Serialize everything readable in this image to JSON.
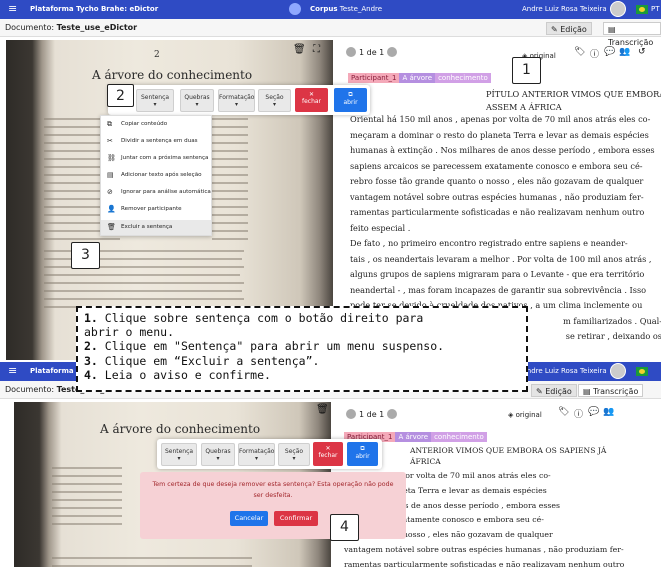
{
  "topbar": {
    "brand": "Plataforma Tycho Brahe: eDictor",
    "corpus_prefix": "Corpus",
    "corpus_name": "Teste_Andre",
    "user": "Andre Luiz Rosa Teixeira",
    "lang": "PT"
  },
  "docbar": {
    "label": "Documento:",
    "doc": "Teste_use_eDictor",
    "tab_edit": "Edição",
    "tab_trans": "Transcrição"
  },
  "image": {
    "page_num": "2",
    "title": "A árvore do conhecimento"
  },
  "nav": {
    "page": "1 de 1",
    "original": "original"
  },
  "tags": {
    "participant": "Participant_1",
    "tag2": "A árvore",
    "tag3": "conhecimento"
  },
  "toolbar": {
    "sentenca": "Sentença",
    "quebras": "Quebras",
    "formatacao": "Formatação",
    "secao": "Seção",
    "fechar": "fechar",
    "abrir": "abrir"
  },
  "menu": {
    "items": [
      "Copiar conteúdo",
      "Dividir a sentença em duas",
      "Juntar com a próxima sentença",
      "Adicionar texto após seleção",
      "Ignorar para análise automática",
      "Remover participante",
      "Excluir a sentença"
    ]
  },
  "text": {
    "l1": "PÍTULO ANTERIOR VIMOS QUE EMBORA OS SAPIENS JÁ",
    "l2": "ASSEM A ÁFRICA",
    "p": [
      "Oriental há 150 mil anos , apenas por volta de 70 mil anos atrás eles co-",
      "meçaram a dominar o resto do planeta Terra e levar as demais espécies",
      "humanas à extinção . Nos milhares de anos desse período , embora esses",
      "sapiens arcaicos se parecessem exatamente conosco e embora seu cé-",
      "rebro fosse tão grande quanto o nosso , eles não gozavam de qualquer",
      "vantagem notável sobre outras espécies humanas , não produziam fer-",
      "ramentas particularmente sofisticadas e não realizavam nenhum outro",
      "feito especial .",
      "De fato , no primeiro encontro registrado entre sapiens e neander-",
      "tais , os neandertais levaram a melhor . Por volta de 100 mil anos atrás ,",
      "alguns grupos de sapiens migraram para o Levante - que era território",
      "neandertal - , mas foram incapazes de garantir sua sobrevivência . Isso",
      "pode ter se devido à crueldade dos nativos , a um clima inclemente ou",
      "m familiarizados . Qual-",
      "se retirar , deixando os"
    ]
  },
  "instructions": {
    "n1": "1.",
    "t1": " Clique sobre sentença com o botão direito para",
    "t1b": "abrir o menu.",
    "n2": "2.",
    "t2": " Clique em \"Sentença\" para abrir um menu suspenso.",
    "n3": "3.",
    "t3": " Clique em “Excluir a sentença”.",
    "n4": "4.",
    "t4": " Leia o aviso e confirme."
  },
  "dialog": {
    "msg": "Tem certeza de que deseja remover esta sentença? Esta operação não pode ser desfeita.",
    "cancel": "Cancelar",
    "confirm": "Confirmar"
  },
  "bottom_text": {
    "h1": "ANTERIOR VIMOS QUE EMBORA OS SAPIENS JÁ",
    "h2": "ÁFRICA",
    "p": [
      "anos , apenas por volta de 70 mil anos atrás eles co-",
      "o resto do planeta Terra e levar as demais espécies",
      "o . Nos milhares de anos desse período , embora esses",
      "parecessem exatamente conosco e embora seu cé-",
      "ande quanto o nosso , eles não gozavam de qualquer",
      "vantagem notável sobre outras espécies humanas , não produziam fer-",
      "ramentas particularmente sofisticadas e não realizavam nenhum outro"
    ]
  },
  "callouts": [
    "1",
    "2",
    "3",
    "4"
  ]
}
